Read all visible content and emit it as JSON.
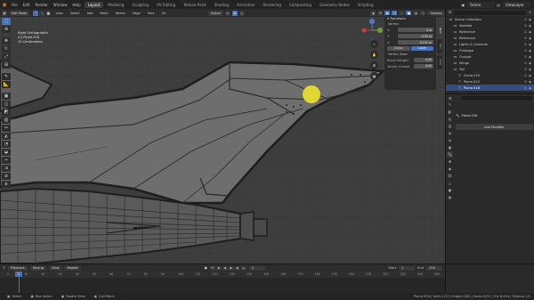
{
  "menu": {
    "file": "File",
    "edit": "Edit",
    "render": "Render",
    "window": "Window",
    "help": "Help"
  },
  "workspaces": [
    "Layout",
    "Modeling",
    "Sculpting",
    "UV Editing",
    "Texture Paint",
    "Shading",
    "Animation",
    "Rendering",
    "Compositing",
    "Geometry Nodes",
    "Scripting"
  ],
  "scene_name": "Scene",
  "view_layer": "ViewLayer",
  "viewport_header": {
    "mode": "Edit Mode",
    "view": "View",
    "select": "Select",
    "add": "Add",
    "mesh": "Mesh",
    "vertex": "Vertex",
    "edge": "Edge",
    "face": "Face",
    "uv": "UV",
    "orientation": "Global",
    "options": "Options"
  },
  "overlay_text": {
    "line1": "Right Orthographic",
    "line2": "(2) Plane.018",
    "line3": "10 Centimeters"
  },
  "npanel": {
    "section": "Transform",
    "sub": "Vertex:",
    "x_label": "X:",
    "y_label": "Y:",
    "z_label": "Z:",
    "x": "0 m",
    "y": "-0.55 m",
    "z": "0.151 m",
    "global": "Global",
    "local": "Local",
    "vertex_data": "Vertex Data:",
    "bevel_weight_label": "Bevel Weight:",
    "bevel_weight": "0.00",
    "crease_label": "Vertex Crease:",
    "crease": "0.00",
    "tabs": [
      "Item",
      "Tool",
      "View"
    ]
  },
  "outliner": {
    "items": [
      {
        "name": "Scene Collection",
        "icon": "collection-icon",
        "depth": 0,
        "selected": false
      },
      {
        "name": "Skeletal",
        "icon": "collection-icon",
        "depth": 1,
        "selected": false
      },
      {
        "name": "Reference",
        "icon": "collection-icon",
        "depth": 1,
        "selected": false
      },
      {
        "name": "Reference",
        "icon": "collection-icon",
        "depth": 1,
        "selected": false
      },
      {
        "name": "Lights & Cameras",
        "icon": "collection-icon",
        "depth": 1,
        "selected": false
      },
      {
        "name": "Fuselage",
        "icon": "collection-icon",
        "depth": 1,
        "selected": false
      },
      {
        "name": "Cockpit",
        "icon": "collection-icon",
        "depth": 1,
        "selected": false
      },
      {
        "name": "Wings",
        "icon": "collection-icon",
        "depth": 1,
        "selected": false
      },
      {
        "name": "Tail",
        "icon": "collection-icon",
        "depth": 1,
        "selected": false
      },
      {
        "name": "Circle.019",
        "icon": "mesh-icon",
        "depth": 2,
        "selected": false
      },
      {
        "name": "Plane.014",
        "icon": "mesh-icon",
        "depth": 2,
        "selected": false
      },
      {
        "name": "Plane.018",
        "icon": "mesh-icon",
        "depth": 2,
        "selected": true
      }
    ]
  },
  "properties": {
    "object_name": "Plane.018",
    "add_modifier": "Add Modifier"
  },
  "timeline": {
    "playback": "Playback",
    "keying": "Keying",
    "view": "View",
    "marker": "Marker",
    "current_frame": "2",
    "start_label": "Start",
    "start": "1",
    "end_label": "End",
    "end": "250",
    "ticks": [
      "0",
      "10",
      "20",
      "30",
      "40",
      "50",
      "60",
      "70",
      "80",
      "90",
      "100",
      "110",
      "120",
      "130",
      "140",
      "150",
      "160",
      "170",
      "180",
      "190",
      "200",
      "210",
      "220",
      "230",
      "240",
      "250"
    ]
  },
  "statusbar": {
    "select": "Select",
    "box_select": "Box Select",
    "rotate_view": "Rotate View",
    "call_menu": "Call Menu",
    "stats": "Plane.018 | Verts 1/32 | Edges 0/62 | Faces 0/31 | Tris 8,454 | Objects 1/1"
  },
  "colors": {
    "accent": "#4772b3",
    "cursor_highlight": "#e6dc2e",
    "mesh_fill": "#6e6e6e",
    "background": "#3d3d3d"
  }
}
